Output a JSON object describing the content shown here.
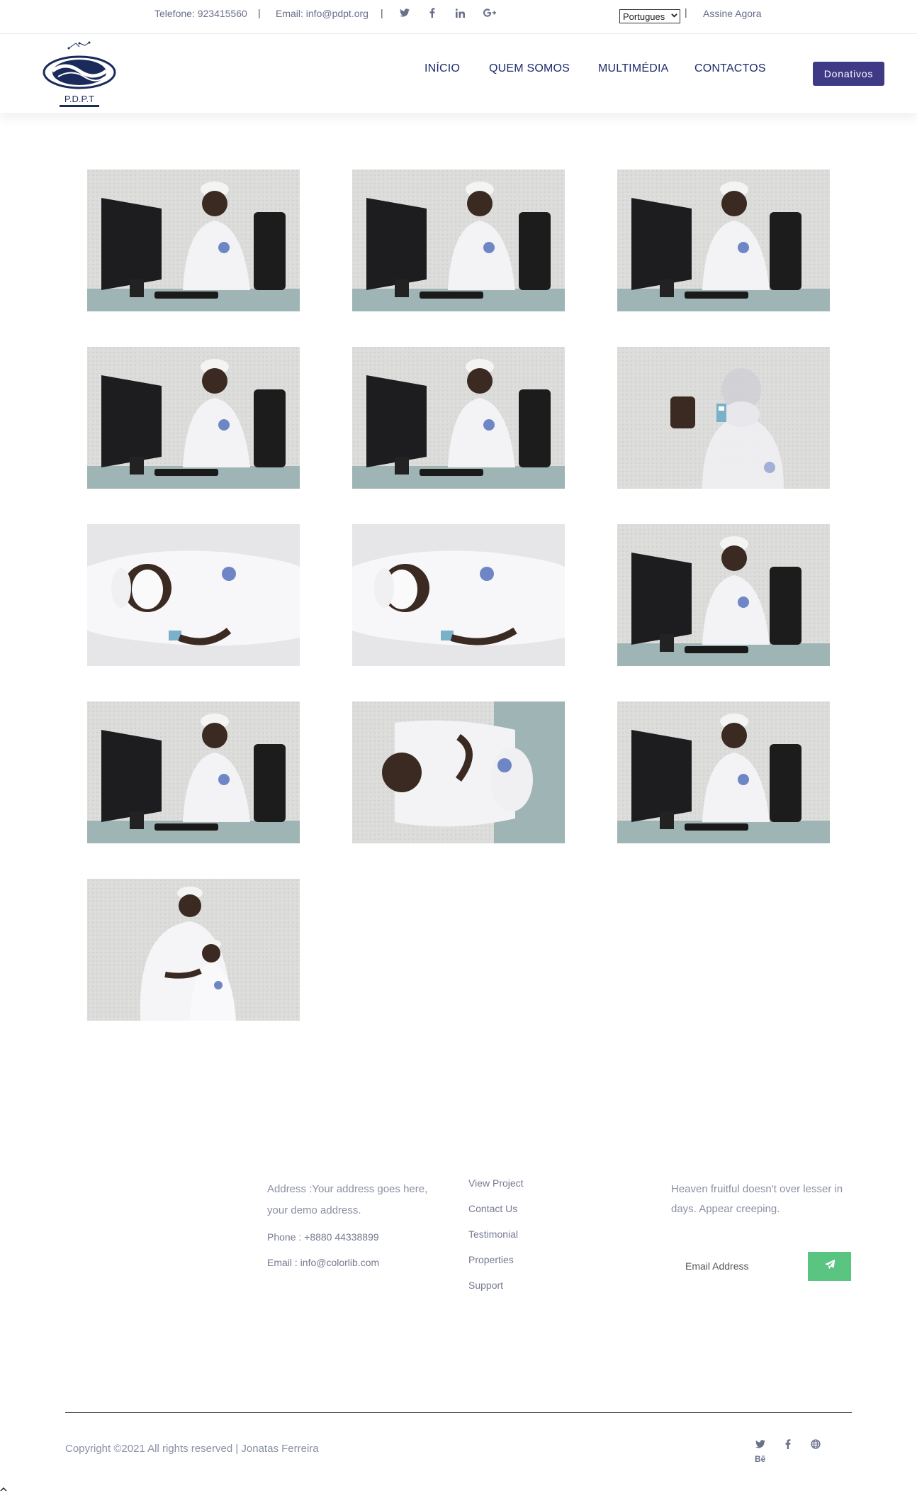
{
  "topbar": {
    "phone": "Telefone: 923415560",
    "email": "Email: info@pdpt.org",
    "sep": "|",
    "language": "Portugues",
    "subscribe": "Assine Agora"
  },
  "header": {
    "logo_text": "P.D.P.T",
    "nav": [
      "INÍCIO",
      "QUEM SOMOS",
      "MULTIMÉDIA",
      "CONTACTOS"
    ],
    "donate": "Donativos"
  },
  "gallery": {
    "photos": [
      {
        "alt": "young man with glasses at computer, holding glasses"
      },
      {
        "alt": "young man typing at computer"
      },
      {
        "alt": "young man smiling at computer keyboard"
      },
      {
        "alt": "young man typing at computer, smiling"
      },
      {
        "alt": "young man smiling at keyboard"
      },
      {
        "alt": "masked person holding small card"
      },
      {
        "alt": "masked person holding card, rotated"
      },
      {
        "alt": "masked person holding card, rotated"
      },
      {
        "alt": "young man at computer with cap on desk"
      },
      {
        "alt": "young man with cap at computer"
      },
      {
        "alt": "young man in cap, rotated"
      },
      {
        "alt": "young man typing, side view"
      },
      {
        "alt": "young man with child"
      }
    ]
  },
  "footer": {
    "address": "Address :Your address goes here, your demo address.",
    "phone": "Phone : +8880 44338899",
    "email": "Email : info@colorlib.com",
    "links": [
      "View Project",
      "Contact Us",
      "Testimonial",
      "Properties",
      "Support"
    ],
    "newsletter_text": "Heaven fruitful doesn't over lesser in days. Appear creeping.",
    "email_placeholder": "Email Address",
    "copyright": "Copyright ©2021 All rights reserved | Jonatas Ferreira",
    "behance": "Bē"
  },
  "colors": {
    "nav": "#1c2a6b",
    "donate_bg": "#3f3a86",
    "send_bg": "#5ac481"
  }
}
